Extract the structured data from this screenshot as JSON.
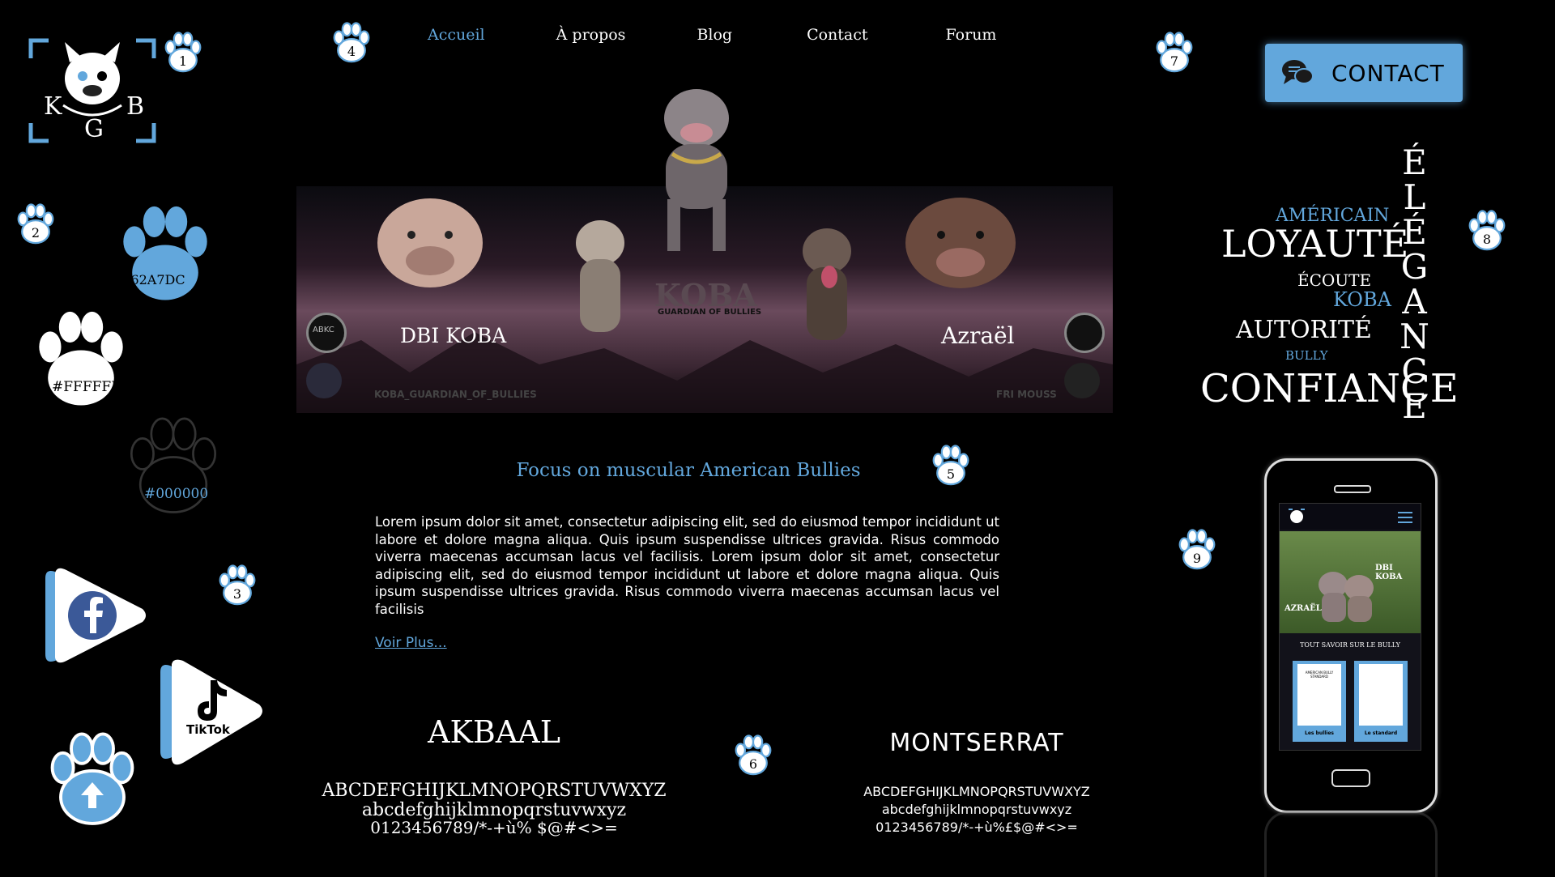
{
  "nav": {
    "items": [
      {
        "label": "Accueil",
        "active": true
      },
      {
        "label": "À propos",
        "active": false
      },
      {
        "label": "Blog",
        "active": false
      },
      {
        "label": "Contact",
        "active": false
      },
      {
        "label": "Forum",
        "active": false
      }
    ]
  },
  "logo": {
    "letters": [
      "K",
      "B",
      "G"
    ]
  },
  "contact_button": {
    "label": "CONTACT",
    "icon": "chat-bubbles-icon"
  },
  "paw_numbers": [
    "1",
    "2",
    "3",
    "4",
    "5",
    "6",
    "7",
    "8",
    "9"
  ],
  "swatches": [
    {
      "label": "#62A7DC",
      "color": "#62A7DC"
    },
    {
      "label": "#FFFFFF",
      "color": "#FFFFFF"
    },
    {
      "label": "#000000",
      "color": "#000000"
    }
  ],
  "hero": {
    "left_name": "DBI KOBA",
    "right_name": "Azraël",
    "center_logo": "KOBA",
    "center_sub": "GUARDIAN OF BULLIES",
    "left_handle": "KOBA_GUARDIAN_OF_BULLIES",
    "right_handle": "FRI MOUSS",
    "badge_left": "ABKC"
  },
  "content": {
    "heading": "Focus on muscular American Bullies",
    "paragraph": "Lorem ipsum dolor sit amet, consectetur adipiscing elit, sed do eiusmod tempor incididunt ut labore et dolore magna aliqua. Quis ipsum suspendisse ultrices gravida. Risus commodo viverra maecenas accumsan lacus vel facilisis. Lorem ipsum dolor sit amet, consectetur adipiscing elit, sed do eiusmod tempor incididunt ut labore et dolore magna aliqua. Quis ipsum suspendisse ultrices gravida. Risus commodo viverra maecenas accumsan lacus vel facilisis",
    "more_link": "Voir Plus..."
  },
  "fonts": {
    "akbaal": {
      "name": "AKBAAL",
      "upper": "ABCDEFGHIJKLMNOPQRSTUVWXYZ",
      "lower": "abcdefghijklmnopqrstuvwxyz",
      "digits": "0123456789/*-+ù% $@#<>="
    },
    "montserrat": {
      "name": "MONTSERRAT",
      "upper": "ABCDEFGHIJKLMNOPQRSTUVWXYZ",
      "lower": "abcdefghijklmnopqrstuvwxyz",
      "digits": "0123456789/*-+ù%£$@#<>="
    }
  },
  "wordcloud": {
    "americain": "AMÉRICAIN",
    "loyaute": "LOYAUTÉ",
    "ecoute": "ÉCOUTE",
    "koba": "KOBA",
    "autorite": "AUTORITÉ",
    "bully": "BULLY",
    "confiance": "CONFIANCE",
    "elegance": "ÉLÉGANCE"
  },
  "social": {
    "facebook": "facebook-icon",
    "tiktok_label": "TikTok",
    "scroll_up": "arrow-up-icon"
  },
  "phone": {
    "right_name": "DBI KOBA",
    "left_name": "AZRAËL",
    "section_title": "TOUT SAVOIR SUR LE BULLY",
    "card1_title": "AMERICAN BULLY STANDARD",
    "card1_caption": "Les bullies",
    "card2_caption": "Le standard"
  },
  "colors": {
    "accent": "#62A7DC",
    "background": "#000000",
    "text": "#FFFFFF"
  }
}
